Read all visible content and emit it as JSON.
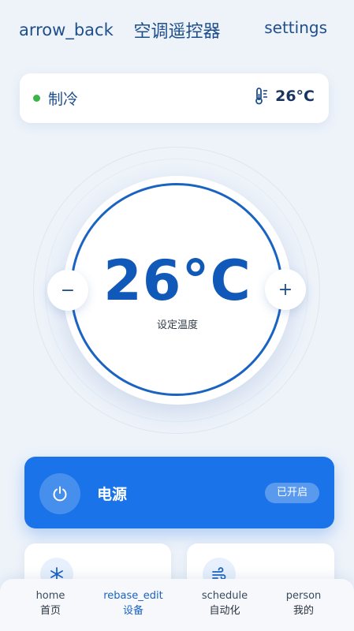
{
  "header": {
    "back_icon_name": "arrow_back",
    "title": "空调遥控器",
    "settings_icon_name": "settings"
  },
  "status": {
    "mode": "制冷",
    "current_temp": "26°C",
    "dot_color": "#3bb54a"
  },
  "dial": {
    "temp": "26°C",
    "label": "设定温度",
    "minus": "−",
    "plus": "+",
    "accent_color": "#1a63c0"
  },
  "power": {
    "label": "电源",
    "badge": "已开启",
    "color": "#1a73e8"
  },
  "tiles": [
    {
      "icon": "snowflake-icon"
    },
    {
      "icon": "wind-icon"
    }
  ],
  "nav": [
    {
      "icon": "home",
      "label": "首页"
    },
    {
      "icon": "rebase_edit",
      "label": "设备"
    },
    {
      "icon": "schedule",
      "label": "自动化"
    },
    {
      "icon": "person",
      "label": "我的"
    }
  ]
}
